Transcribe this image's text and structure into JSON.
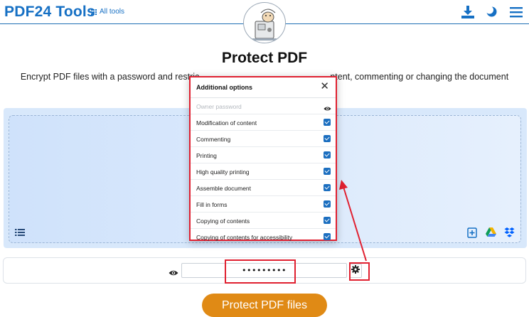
{
  "header": {
    "logo": "PDF24 Tools",
    "all_tools": "All tools",
    "icons": [
      "grid-icon",
      "download-icon",
      "dark-mode-icon",
      "menu-icon"
    ]
  },
  "main": {
    "title": "Protect PDF",
    "subtitle": "Encrypt PDF files with a password and restric",
    "subtitle_tail": "ntent, commenting or changing the document"
  },
  "options_dialog": {
    "title": "Additional options",
    "owner_password_placeholder": "Owner password",
    "options": [
      {
        "label": "Modification of content",
        "checked": true
      },
      {
        "label": "Commenting",
        "checked": true
      },
      {
        "label": "Printing",
        "checked": true
      },
      {
        "label": "High quality printing",
        "checked": true
      },
      {
        "label": "Assemble document",
        "checked": true
      },
      {
        "label": "Fill in forms",
        "checked": true
      },
      {
        "label": "Copying of contents",
        "checked": true
      },
      {
        "label": "Copying of contents for accessibility",
        "checked": true
      }
    ]
  },
  "password": {
    "value": "•••••••••"
  },
  "actions": {
    "protect_label": "Protect PDF files"
  },
  "colors": {
    "brand_blue": "#1670c4",
    "highlight_red": "#e02030",
    "button_orange": "#e08a15",
    "dropzone_bg": "#d8e8fb"
  }
}
